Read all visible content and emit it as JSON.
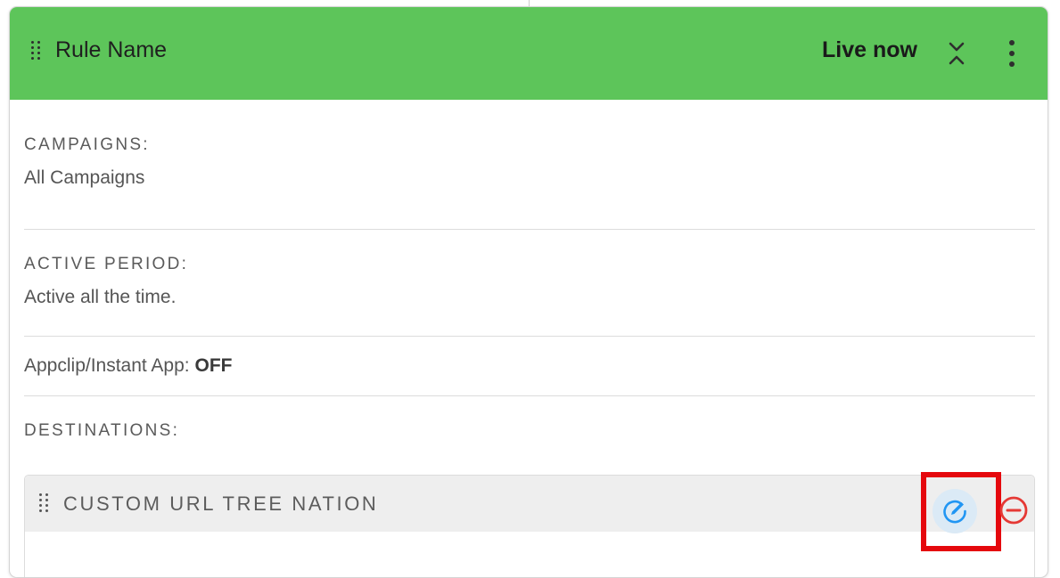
{
  "rule": {
    "name": "Rule Name",
    "status": "Live now"
  },
  "sections": {
    "campaigns": {
      "label": "CAMPAIGNS:",
      "value": "All Campaigns"
    },
    "active_period": {
      "label": "ACTIVE PERIOD:",
      "value": "Active all the time."
    },
    "appclip": {
      "label": "Appclip/Instant App:",
      "value": "OFF"
    },
    "destinations": {
      "label": "DESTINATIONS:",
      "items": [
        {
          "title": "CUSTOM URL TREE NATION"
        }
      ]
    }
  },
  "icons": {
    "drag": "drag-handle-icon",
    "collapse": "collapse-chevrons-icon",
    "menu": "kebab-menu-icon",
    "edit": "edit-pencil-icon",
    "remove": "remove-circle-icon"
  },
  "colors": {
    "header_green": "#5dc55a",
    "edit_blue": "#2196f3",
    "remove_red": "#e53935",
    "highlight_red": "#e5080d"
  }
}
